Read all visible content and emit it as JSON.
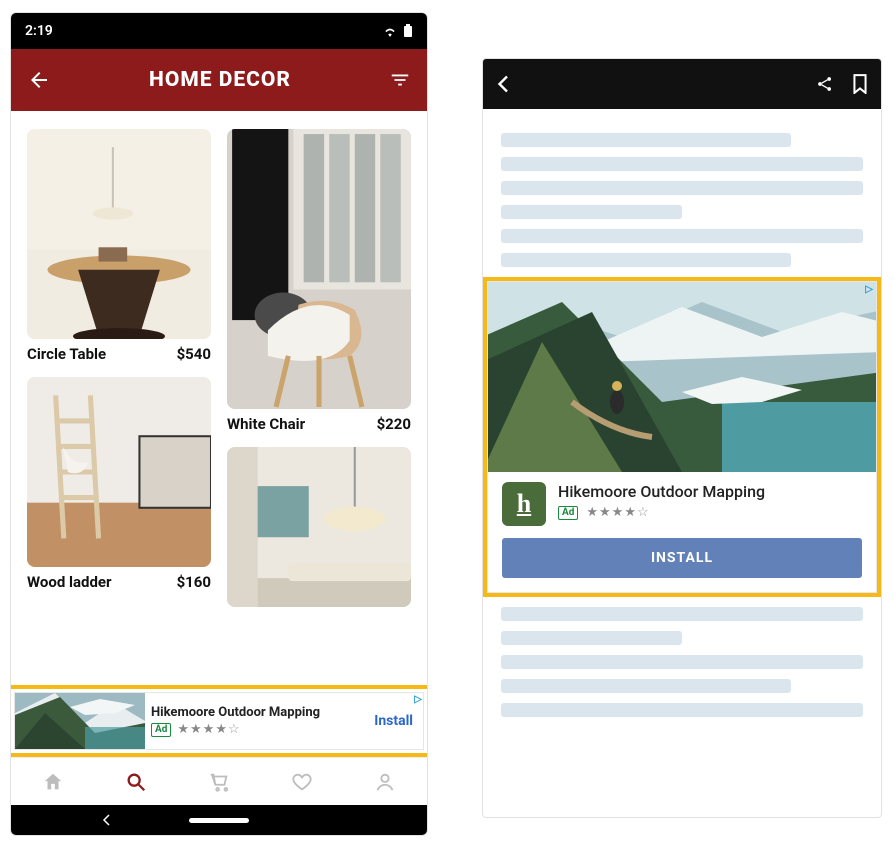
{
  "statusbar": {
    "time": "2:19"
  },
  "appbar": {
    "title": "HOME DECOR"
  },
  "products": {
    "circle_table": {
      "name": "Circle Table",
      "price": "$540"
    },
    "white_chair": {
      "name": "White Chair",
      "price": "$220"
    },
    "wood_ladder": {
      "name": "Wood ladder",
      "price": "$160"
    }
  },
  "banner_ad": {
    "title": "Hikemoore Outdoor Mapping",
    "badge": "Ad",
    "cta": "Install",
    "rating": 4
  },
  "native_ad": {
    "title": "Hikemoore Outdoor Mapping",
    "badge": "Ad",
    "cta": "INSTALL",
    "rating": 4,
    "app_icon_letter": "h"
  }
}
